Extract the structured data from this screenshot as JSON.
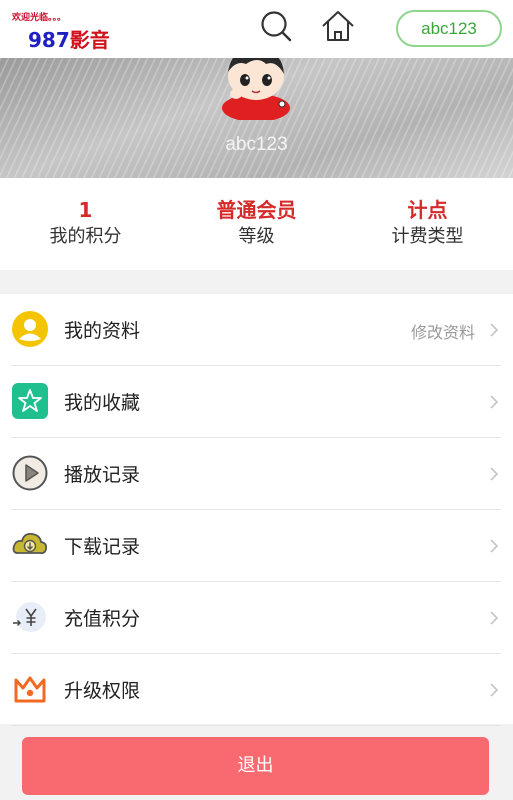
{
  "header": {
    "logo_small": "欢迎光临。。。",
    "logo_num": "987",
    "logo_text": "影音",
    "search_icon": "search-icon",
    "home_icon": "home-icon",
    "username": "abc123"
  },
  "banner": {
    "username": "abc123"
  },
  "stats": [
    {
      "value": "1",
      "label": "我的积分"
    },
    {
      "value": "普通会员",
      "label": "等级"
    },
    {
      "value": "计点",
      "label": "计费类型"
    }
  ],
  "menu": [
    {
      "icon": "profile-icon",
      "label": "我的资料",
      "hint": "修改资料"
    },
    {
      "icon": "star-icon",
      "label": "我的收藏",
      "hint": ""
    },
    {
      "icon": "play-icon",
      "label": "播放记录",
      "hint": ""
    },
    {
      "icon": "download-cloud-icon",
      "label": "下载记录",
      "hint": ""
    },
    {
      "icon": "yuan-recharge-icon",
      "label": "充值积分",
      "hint": ""
    },
    {
      "icon": "crown-icon",
      "label": "升级权限",
      "hint": ""
    }
  ],
  "logout_label": "退出",
  "colors": {
    "accent_red": "#d62a2a",
    "logout_bg": "#f96a70",
    "pill_green": "#3aa63a"
  }
}
